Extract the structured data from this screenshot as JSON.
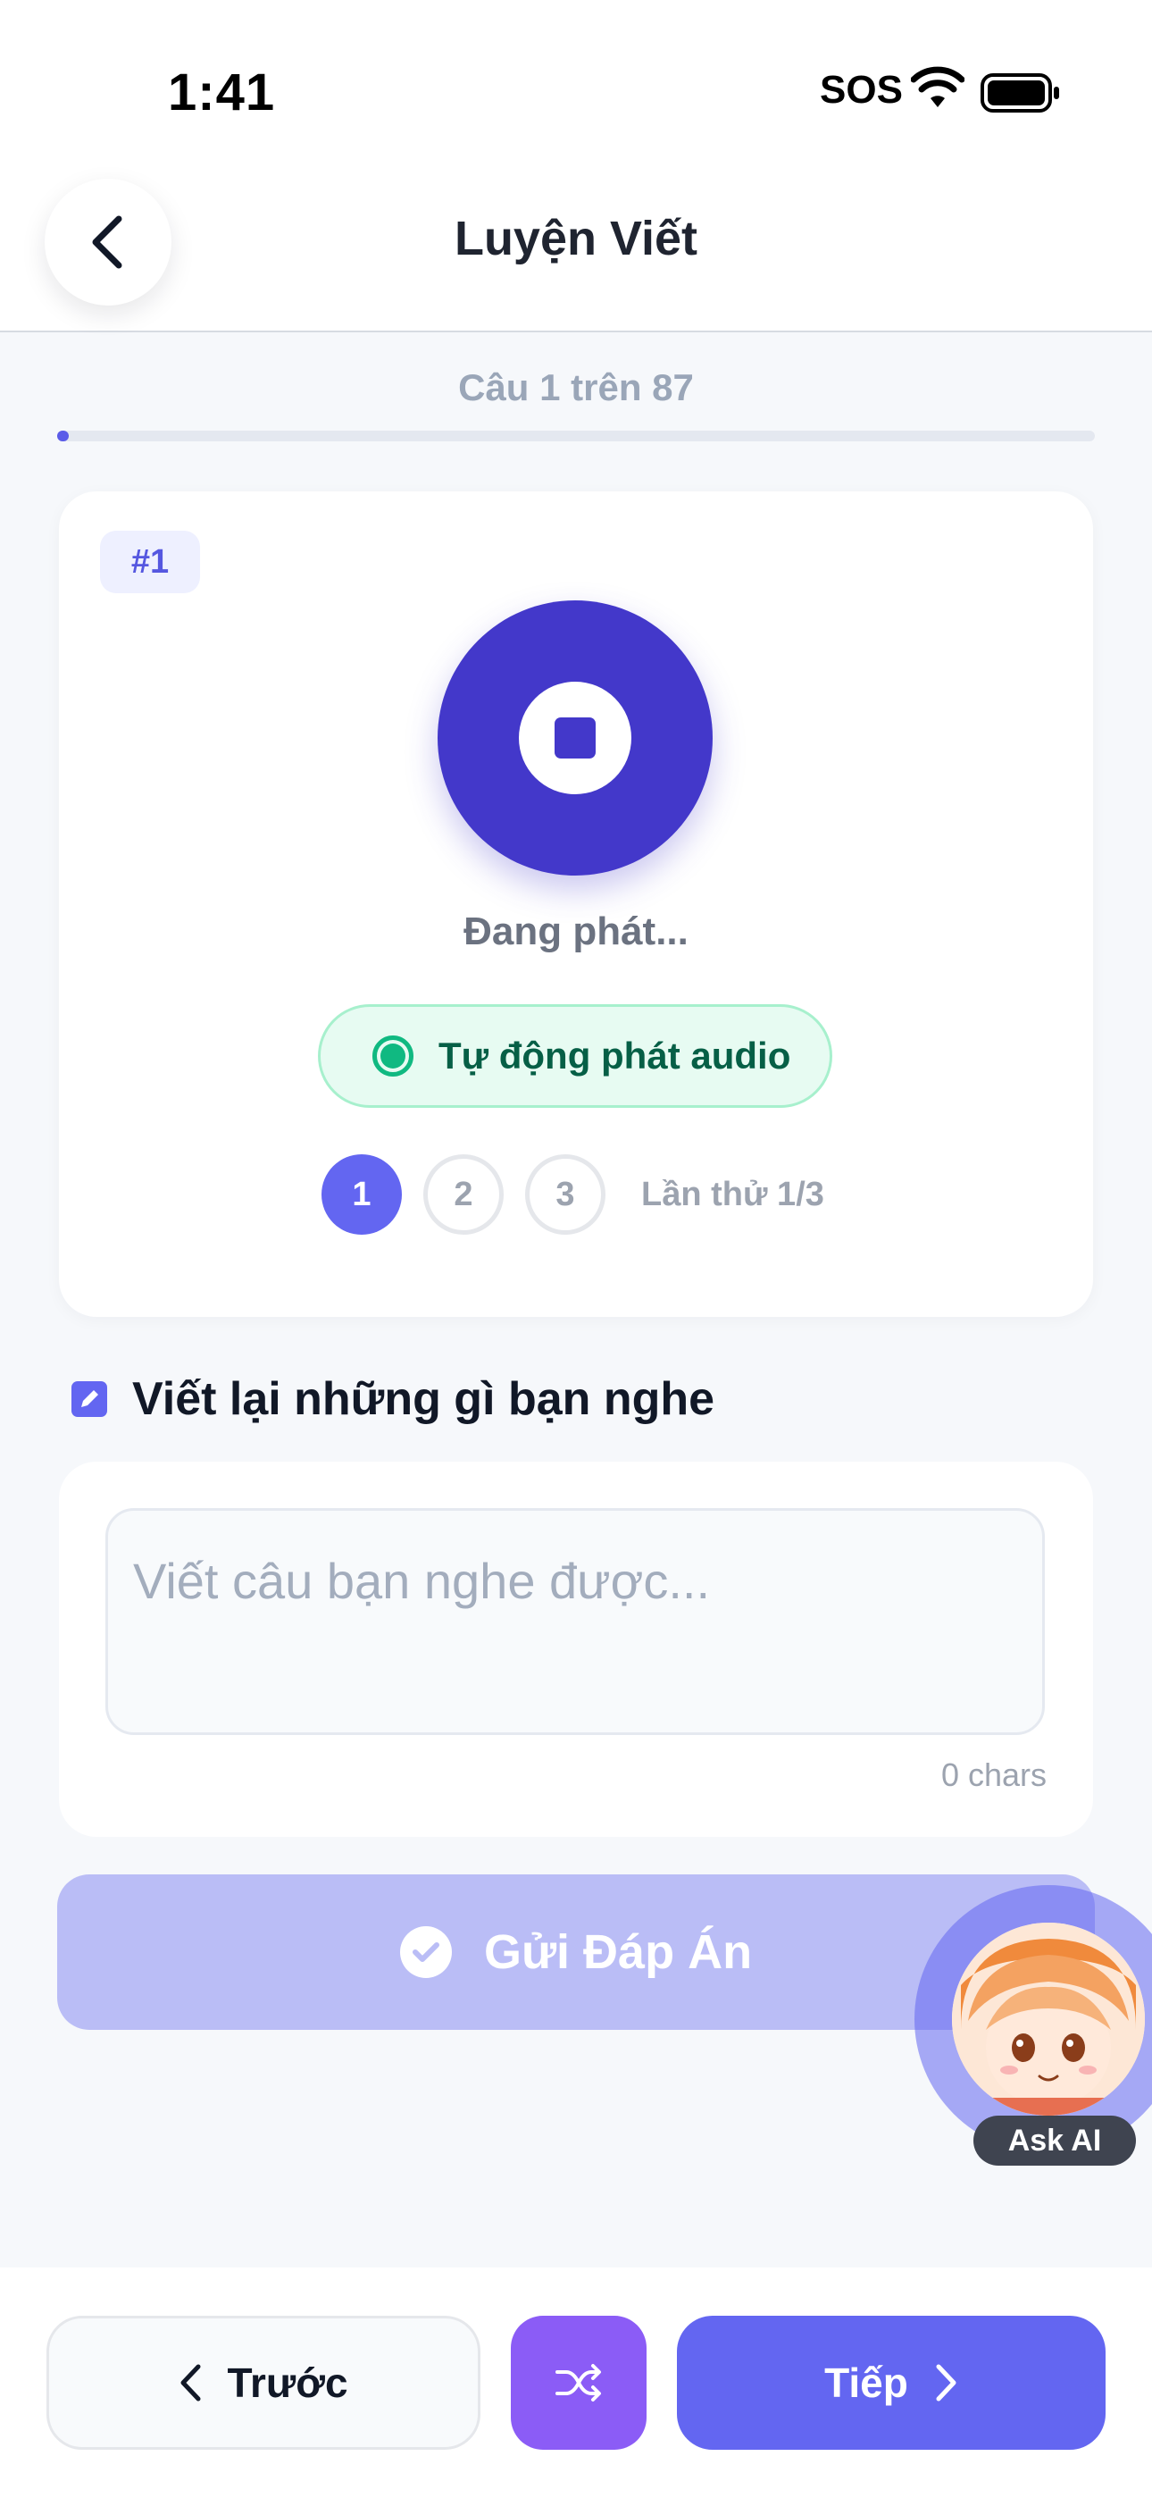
{
  "status_bar": {
    "time": "1:41",
    "carrier": "SOS"
  },
  "header": {
    "title": "Luyện Viết"
  },
  "progress": {
    "label": "Câu 1 trên 87",
    "current": 1,
    "total": 87
  },
  "audio_card": {
    "badge": "#1",
    "state_text": "Đang phát...",
    "auto_play_label": "Tự động phát audio",
    "attempts": [
      "1",
      "2",
      "3"
    ],
    "attempt_label": "Lần thử 1/3"
  },
  "write_section": {
    "title": "Viết lại những gì bạn nghe",
    "placeholder": "Viết câu bạn nghe được...",
    "value": "",
    "char_count": "0 chars"
  },
  "submit": {
    "label": "Gửi Đáp Án"
  },
  "ask_ai": {
    "label": "Ask AI"
  },
  "bottom_nav": {
    "prev_label": "Trước",
    "next_label": "Tiếp"
  },
  "colors": {
    "primary": "#6366f1",
    "play_button": "#4338ca",
    "shuffle": "#8b5cf6",
    "success": "#10b981",
    "submit_disabled": "#babdf6"
  },
  "icons": {
    "back": "chevron-left-icon",
    "stop": "stop-icon",
    "edit": "edit-icon",
    "check": "check-circle-icon",
    "shuffle": "shuffle-icon",
    "next": "chevron-right-icon"
  }
}
